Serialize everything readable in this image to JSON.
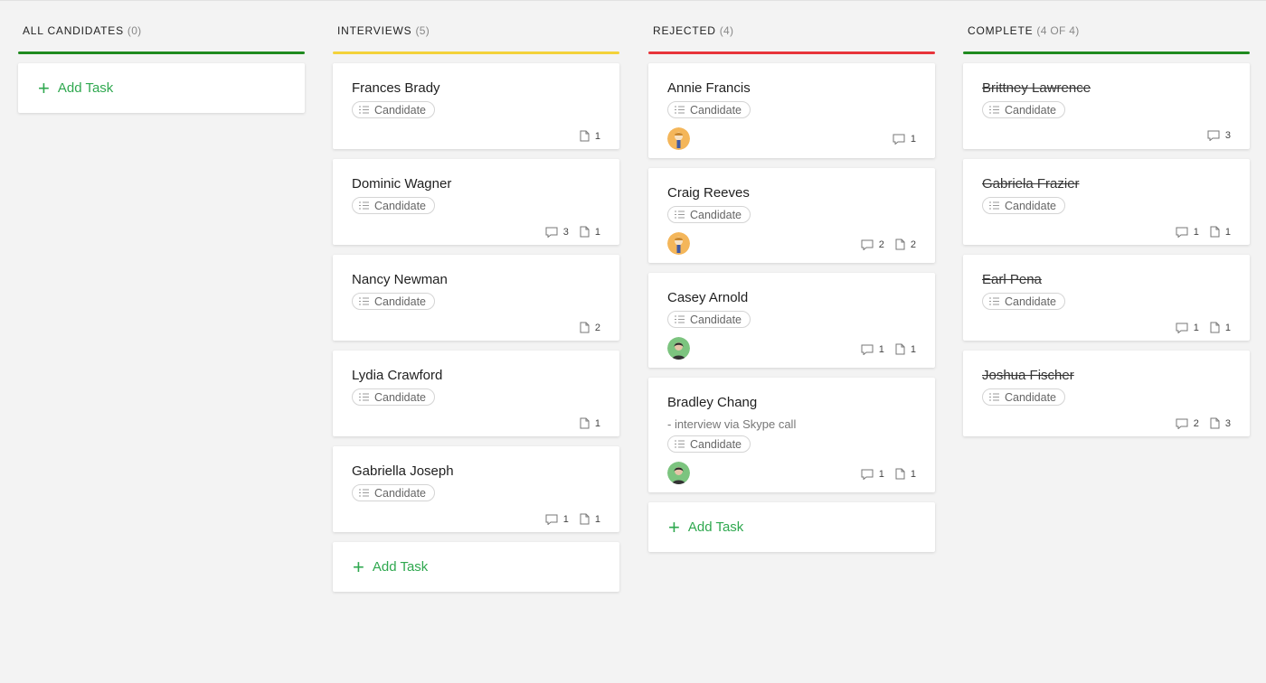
{
  "columns": [
    {
      "title": "ALL CANDIDATES",
      "count": "(0)",
      "color": "#1f8a1f",
      "cards": [],
      "add_label": "Add Task"
    },
    {
      "title": "INTERVIEWS",
      "count": "(5)",
      "color": "#f3d23a",
      "cards": [
        {
          "name": "Frances Brady",
          "tag": "Candidate",
          "comments": "",
          "files": "1"
        },
        {
          "name": "Dominic Wagner",
          "tag": "Candidate",
          "comments": "3",
          "files": "1"
        },
        {
          "name": "Nancy Newman",
          "tag": "Candidate",
          "comments": "",
          "files": "2"
        },
        {
          "name": "Lydia Crawford",
          "tag": "Candidate",
          "comments": "",
          "files": "1"
        },
        {
          "name": "Gabriella Joseph",
          "tag": "Candidate",
          "comments": "1",
          "files": "1"
        }
      ],
      "add_label": "Add Task"
    },
    {
      "title": "REJECTED",
      "count": "(4)",
      "color": "#e8343a",
      "cards": [
        {
          "name": "Annie Francis",
          "tag": "Candidate",
          "avatar": "avatar-orange",
          "comments": "1",
          "files": ""
        },
        {
          "name": "Craig Reeves",
          "tag": "Candidate",
          "avatar": "avatar-orange",
          "comments": "2",
          "files": "2"
        },
        {
          "name": "Casey Arnold",
          "tag": "Candidate",
          "avatar": "avatar-green",
          "comments": "1",
          "files": "1"
        },
        {
          "name": "Bradley Chang",
          "note": "- interview via Skype call",
          "tag": "Candidate",
          "avatar": "avatar-green",
          "comments": "1",
          "files": "1"
        }
      ],
      "add_label": "Add Task"
    },
    {
      "title": "COMPLETE",
      "count": "(4 of 4)",
      "color": "#1f8a1f",
      "done": true,
      "cards": [
        {
          "name": "Brittney Lawrence",
          "tag": "Candidate",
          "comments": "3",
          "files": ""
        },
        {
          "name": "Gabriela Frazier",
          "tag": "Candidate",
          "comments": "1",
          "files": "1"
        },
        {
          "name": "Earl Pena",
          "tag": "Candidate",
          "comments": "1",
          "files": "1"
        },
        {
          "name": "Joshua Fischer",
          "tag": "Candidate",
          "comments": "2",
          "files": "3"
        }
      ]
    }
  ],
  "icons": {
    "add": "plus-icon",
    "tag": "list-icon",
    "comment": "comment-icon",
    "file": "file-icon"
  }
}
